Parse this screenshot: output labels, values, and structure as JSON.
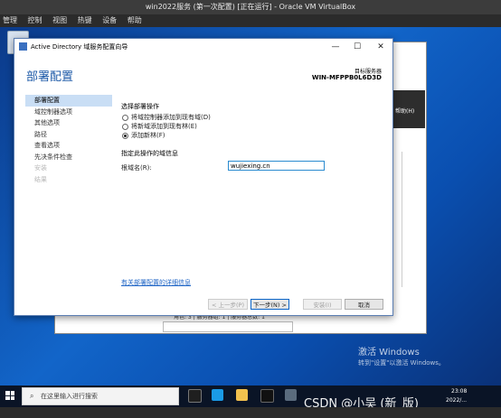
{
  "vbox": {
    "title": "win2022服务 (第一次配置) [正在运行] - Oracle VM VirtualBox",
    "menu": [
      "管理",
      "控制",
      "视图",
      "热键",
      "设备",
      "帮助"
    ]
  },
  "wizard": {
    "window_title": "Active Directory 域服务配置向导",
    "heading": "部署配置",
    "target_label": "目标服务器",
    "target_value": "WIN-MFPPB0L6D3D",
    "nav": [
      {
        "label": "部署配置",
        "state": "active"
      },
      {
        "label": "域控制器选项",
        "state": "normal"
      },
      {
        "label": "其他选项",
        "state": "normal"
      },
      {
        "label": "路径",
        "state": "normal"
      },
      {
        "label": "查看选项",
        "state": "normal"
      },
      {
        "label": "先决条件检查",
        "state": "normal"
      },
      {
        "label": "安装",
        "state": "disabled"
      },
      {
        "label": "结果",
        "state": "disabled"
      }
    ],
    "section1": "选择部署操作",
    "options": [
      {
        "label": "将域控制器添加到现有域(D)",
        "selected": false
      },
      {
        "label": "将新域添加到现有林(E)",
        "selected": false
      },
      {
        "label": "添加新林(F)",
        "selected": true
      }
    ],
    "section2": "指定此操作的域信息",
    "root_domain_label": "根域名(R):",
    "root_domain_value": "wujiexing.cn",
    "more_link": "有关部署配置的详细信息",
    "buttons": {
      "prev": "< 上一步(P)",
      "next": "下一步(N) >",
      "install": "安装(I)",
      "cancel": "取消"
    }
  },
  "background": {
    "dark_text": "帮助(H)",
    "status_text": "角色: 3 | 服务器组: 1 | 服务器总数: 1"
  },
  "watermark": {
    "line1": "激活 Windows",
    "line2": "转到\"设置\"以激活 Windows。"
  },
  "taskbar": {
    "search_placeholder": "在这里输入进行搜索",
    "time": "23:08",
    "date": "2022/..."
  },
  "overlay_text": "CSDN @小吴 (新_版)"
}
